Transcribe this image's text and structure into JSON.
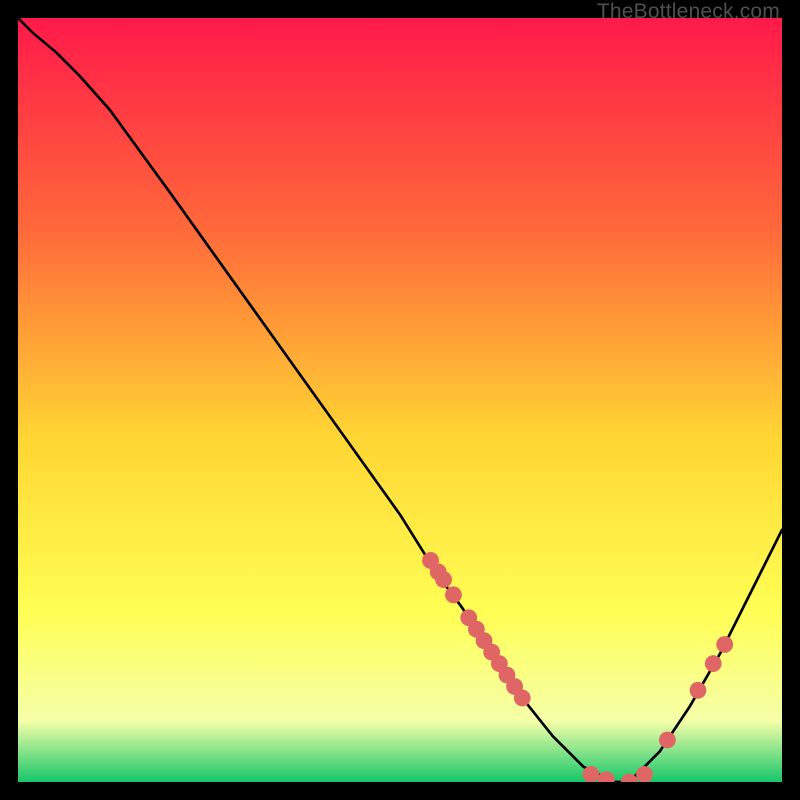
{
  "watermark": "TheBottleneck.com",
  "colors": {
    "curve": "#000000",
    "dot": "#e06666",
    "gradient_top": "#ff1a4a",
    "gradient_mid1": "#ff6a3a",
    "gradient_mid2": "#ffd633",
    "gradient_mid3": "#ffff55",
    "gradient_mid4": "#f5ffa8",
    "gradient_bottom": "#16c76a"
  },
  "chart_data": {
    "type": "line",
    "title": "",
    "xlabel": "",
    "ylabel": "",
    "xlim": [
      0,
      100
    ],
    "ylim": [
      0,
      100
    ],
    "grid": false,
    "legend": false,
    "series": [
      {
        "name": "curve",
        "x": [
          0,
          2,
          5,
          8,
          12,
          16,
          20,
          25,
          30,
          35,
          40,
          45,
          50,
          55,
          58,
          62,
          66,
          70,
          74,
          78,
          80,
          84,
          88,
          92,
          96,
          100
        ],
        "y": [
          100,
          98,
          95.5,
          92.5,
          88,
          82.5,
          77,
          70,
          63,
          56,
          49,
          42,
          35,
          27,
          23,
          17,
          11,
          6,
          2,
          0,
          0,
          4,
          10,
          17,
          25,
          33
        ]
      }
    ],
    "scatter": [
      {
        "x": 54,
        "y": 29
      },
      {
        "x": 55,
        "y": 27.5
      },
      {
        "x": 55.7,
        "y": 26.5
      },
      {
        "x": 57,
        "y": 24.5
      },
      {
        "x": 59,
        "y": 21.5
      },
      {
        "x": 60,
        "y": 20
      },
      {
        "x": 61,
        "y": 18.5
      },
      {
        "x": 62,
        "y": 17
      },
      {
        "x": 63,
        "y": 15.5
      },
      {
        "x": 64,
        "y": 14
      },
      {
        "x": 65,
        "y": 12.5
      },
      {
        "x": 66,
        "y": 11
      },
      {
        "x": 75,
        "y": 1
      },
      {
        "x": 77,
        "y": 0.3
      },
      {
        "x": 80,
        "y": 0
      },
      {
        "x": 82,
        "y": 1
      },
      {
        "x": 85,
        "y": 5.5
      },
      {
        "x": 89,
        "y": 12
      },
      {
        "x": 91,
        "y": 15.5
      },
      {
        "x": 92.5,
        "y": 18
      }
    ]
  }
}
